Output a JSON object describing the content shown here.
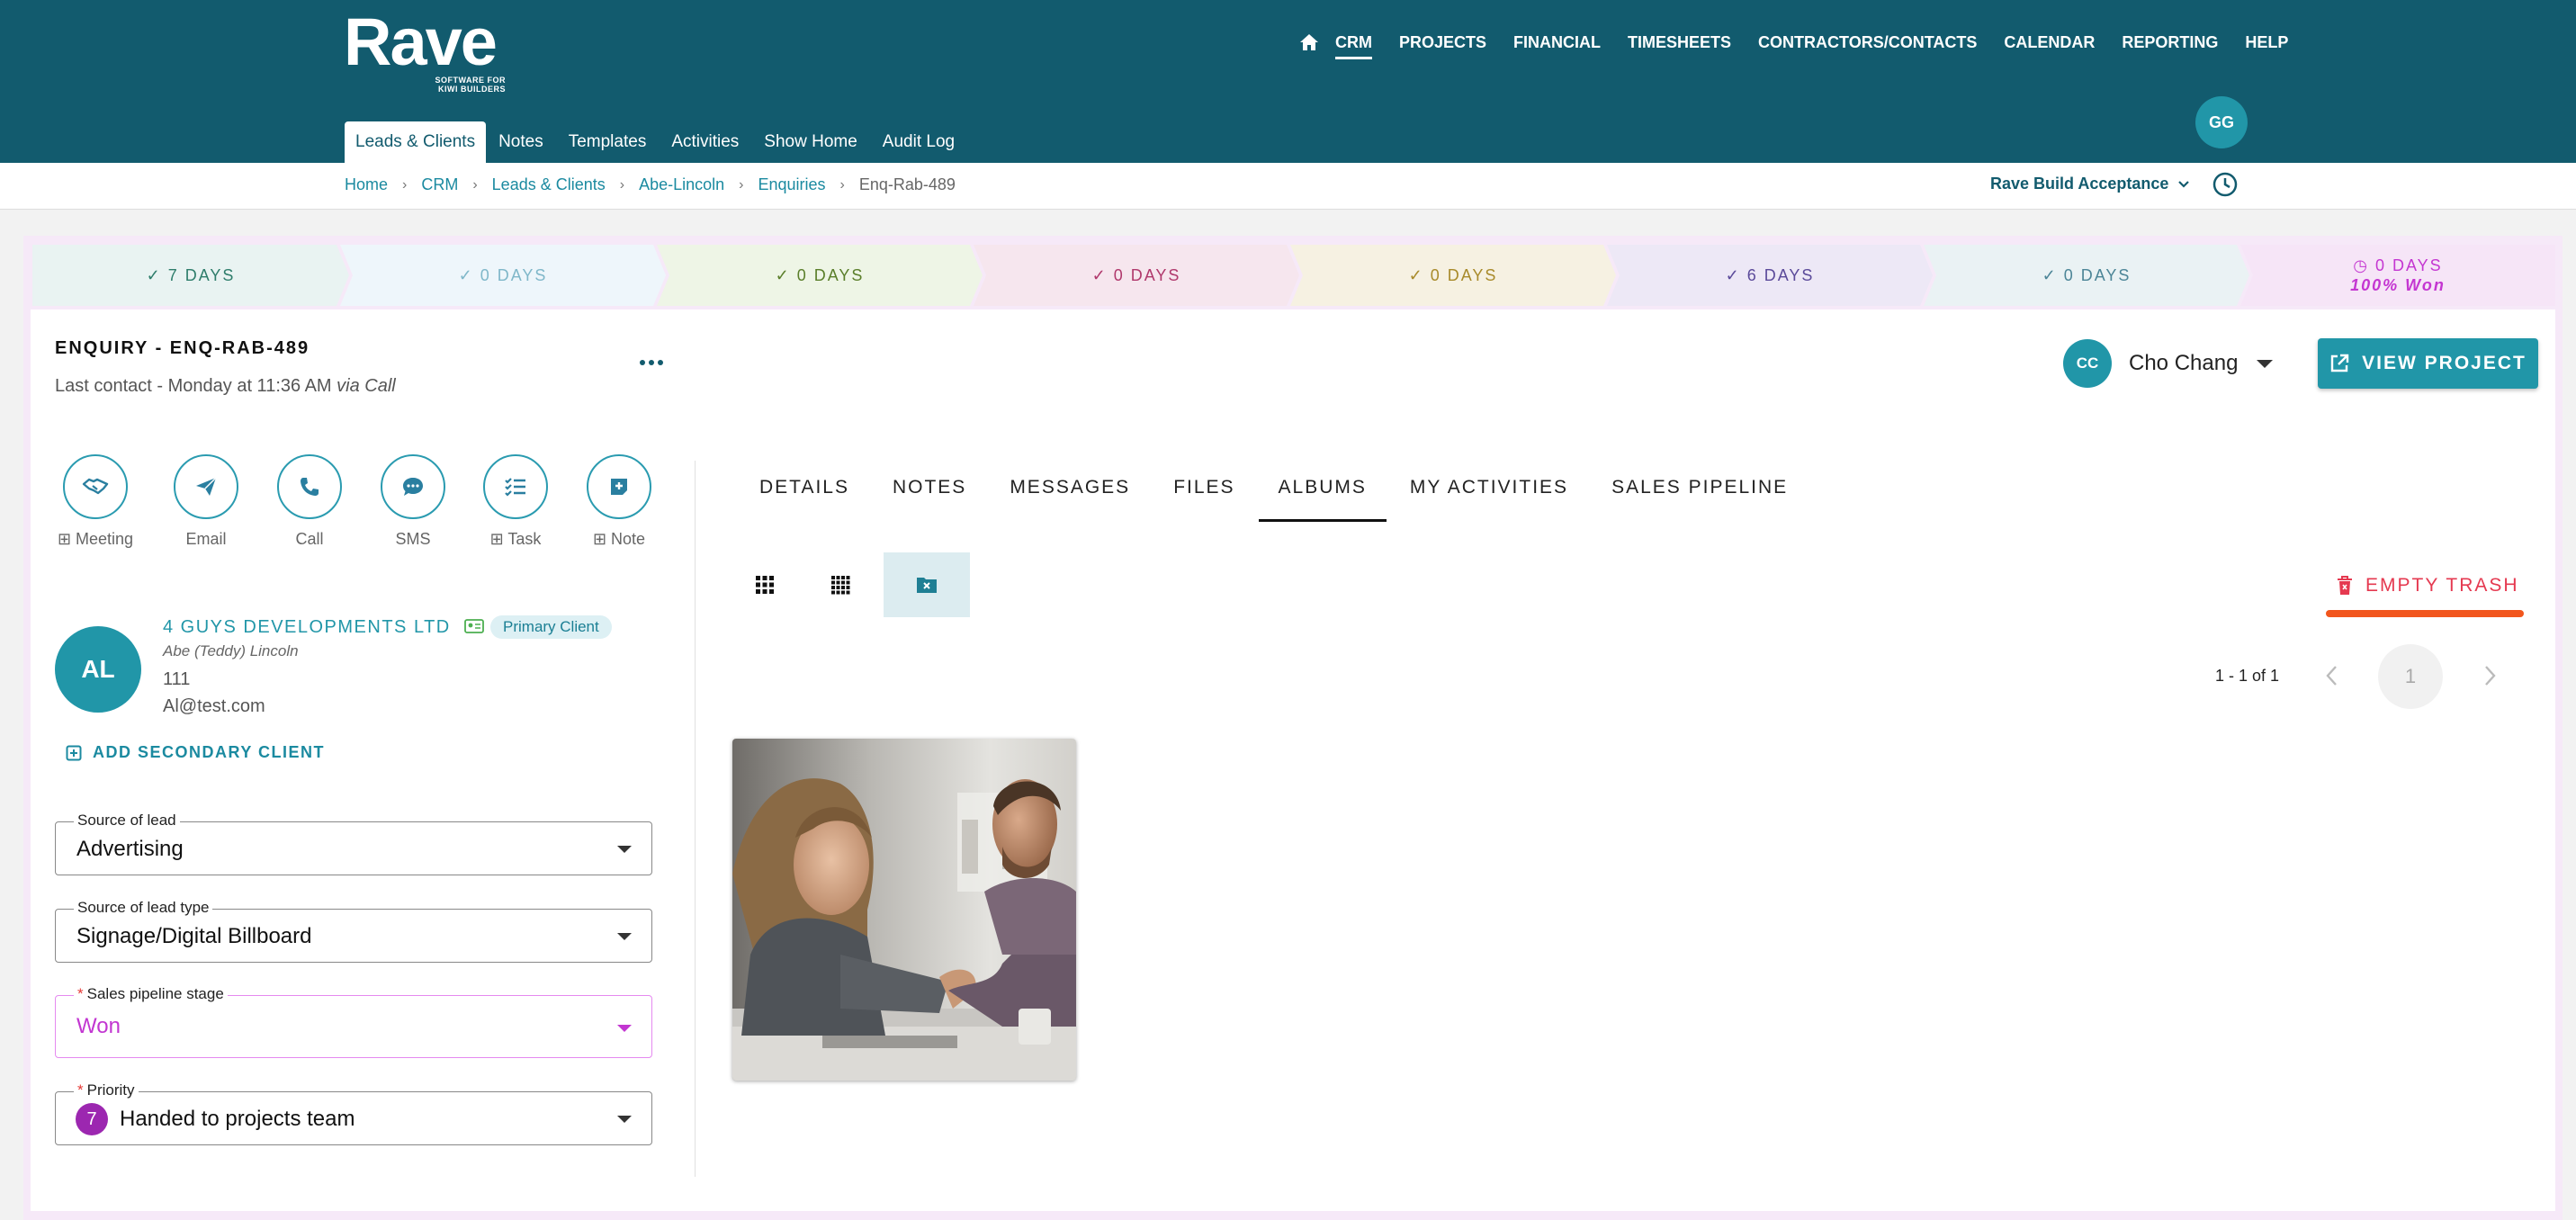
{
  "header": {
    "logo_word": "Rave",
    "logo_tagline_1": "SOFTWARE FOR",
    "logo_tagline_2": "KIWI BUILDERS",
    "nav": [
      "CRM",
      "PROJECTS",
      "FINANCIAL",
      "TIMESHEETS",
      "CONTRACTORS/CONTACTS",
      "CALENDAR",
      "REPORTING",
      "HELP"
    ],
    "subnav": [
      "Leads & Clients",
      "Notes",
      "Templates",
      "Activities",
      "Show Home",
      "Audit Log"
    ],
    "user_initials": "GG"
  },
  "breadcrumb": [
    "Home",
    "CRM",
    "Leads & Clients",
    "Abe-Lincoln",
    "Enquiries",
    "Enq-Rab-489"
  ],
  "company_select": "Rave Build Acceptance",
  "pipeline": [
    {
      "label": "7 DAYS",
      "bg": "#e9f3f2",
      "fg": "#2e7d6b"
    },
    {
      "label": "0 DAYS",
      "bg": "#eef6fb",
      "fg": "#7fb7c9"
    },
    {
      "label": "0 DAYS",
      "bg": "#eef5e6",
      "fg": "#5a7e2a"
    },
    {
      "label": "0 DAYS",
      "bg": "#f6e6ee",
      "fg": "#b0386c"
    },
    {
      "label": "0 DAYS",
      "bg": "#f6f1e2",
      "fg": "#a88a2a"
    },
    {
      "label": "6 DAYS",
      "bg": "#ede8f6",
      "fg": "#5b4a9a"
    },
    {
      "label": "0 DAYS",
      "bg": "#eaf2f4",
      "fg": "#4c8597"
    },
    {
      "label": "0 DAYS",
      "sub": "100% Won",
      "bg": "#f6e5f7",
      "fg": "#c436d1"
    }
  ],
  "enquiry": {
    "title": "ENQUIRY - ENQ-RAB-489",
    "last_contact": "Last contact - Monday at 11:36 AM",
    "via": "via Call"
  },
  "actions": [
    {
      "label": "⊞ Meeting",
      "icon": "handshake-icon"
    },
    {
      "label": "Email",
      "icon": "send-icon"
    },
    {
      "label": "Call",
      "icon": "phone-icon"
    },
    {
      "label": "SMS",
      "icon": "sms-icon"
    },
    {
      "label": "⊞ Task",
      "icon": "checklist-icon"
    },
    {
      "label": "⊞ Note",
      "icon": "add-note-icon"
    }
  ],
  "client": {
    "initials": "AL",
    "company": "4 GUYS DEVELOPMENTS LTD",
    "badge": "Primary Client",
    "contact": "Abe (Teddy) Lincoln",
    "phone": "111",
    "email": "Al@test.com",
    "add_secondary": "ADD SECONDARY CLIENT"
  },
  "fields": {
    "source_label": "Source of lead",
    "source_value": "Advertising",
    "source_type_label": "Source of lead type",
    "source_type_value": "Signage/Digital Billboard",
    "stage_label": "Sales pipeline stage",
    "stage_value": "Won",
    "priority_label": "Priority",
    "priority_number": "7",
    "priority_value": "Handed to projects team",
    "required_mark": "*"
  },
  "assignee": {
    "initials": "CC",
    "name": "Cho Chang"
  },
  "view_project": "VIEW PROJECT",
  "tabs": [
    "DETAILS",
    "NOTES",
    "MESSAGES",
    "FILES",
    "ALBUMS",
    "MY ACTIVITIES",
    "SALES PIPELINE"
  ],
  "active_tab": "ALBUMS",
  "albums": {
    "empty_trash": "EMPTY TRASH",
    "range": "1 - 1 of 1",
    "page": "1"
  },
  "colors": {
    "primary": "#125b6e",
    "accent": "#2196a8",
    "won": "#c236d1",
    "danger": "#e53950"
  }
}
